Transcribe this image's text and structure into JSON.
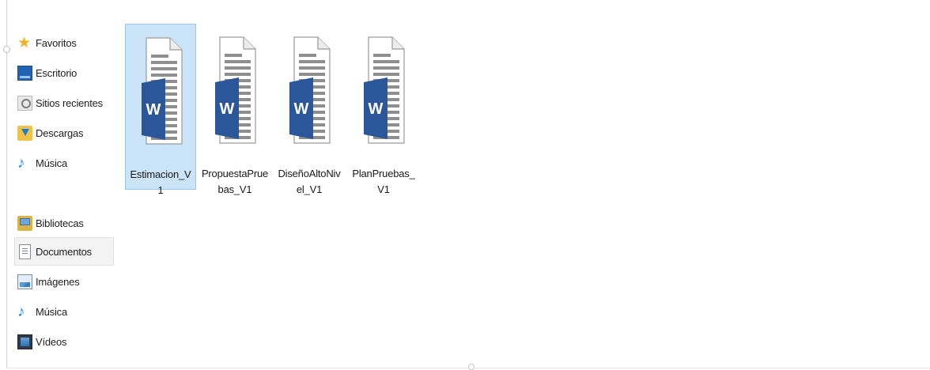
{
  "navigation": {
    "favorites": {
      "label": "Favoritos",
      "items": [
        {
          "label": "Escritorio",
          "icon": "desktop-icon"
        },
        {
          "label": "Sitios recientes",
          "icon": "recent-places-icon"
        },
        {
          "label": "Descargas",
          "icon": "downloads-icon"
        },
        {
          "label": "Música",
          "icon": "music-icon"
        }
      ]
    },
    "libraries": {
      "label": "Bibliotecas",
      "items": [
        {
          "label": "Documentos",
          "icon": "documents-icon",
          "selected": true
        },
        {
          "label": "Imágenes",
          "icon": "pictures-icon"
        },
        {
          "label": "Música",
          "icon": "music-icon"
        },
        {
          "label": "Vídeos",
          "icon": "videos-icon"
        }
      ]
    }
  },
  "files": [
    {
      "name": "Estimacion_V1",
      "type": "word-document-icon",
      "selected": true
    },
    {
      "name": "PropuestaPruebas_V1",
      "type": "word-document-icon",
      "selected": false
    },
    {
      "name": "DiseñoAltoNivel_V1",
      "type": "word-document-icon",
      "selected": false
    },
    {
      "name": "PlanPruebas_V1",
      "type": "word-document-icon",
      "selected": false
    }
  ],
  "colors": {
    "selection": "#cce4f7",
    "word_blue": "#2b579a",
    "nav_selected": "#f3f3f3"
  }
}
